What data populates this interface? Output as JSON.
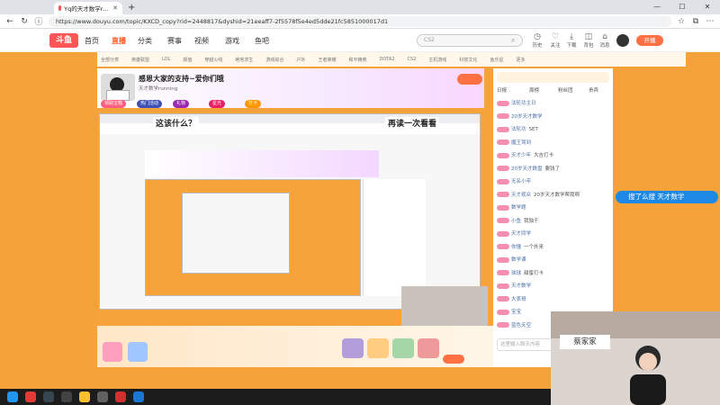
{
  "browser": {
    "tabs": [
      {
        "label": "Yq的天才数学running直播 - 斗鱼"
      },
      {
        "label": "+"
      }
    ],
    "url": "https://www.douyu.com/topic/KXCD_copy?rid=2448817&dyshid=21eeaff7-2f5578f5e4ed5dde21fc5851000017d1",
    "window_controls": [
      "—",
      "☐",
      "✕"
    ]
  },
  "site": {
    "logo": "斗鱼",
    "nav": [
      "首页",
      "直播",
      "分类",
      "赛事",
      "视频",
      "游戏",
      "鱼吧"
    ],
    "search_placeholder": "CS2",
    "header_icons": [
      {
        "icon": "clock-icon",
        "label": "历史"
      },
      {
        "icon": "heart-icon",
        "label": "关注"
      },
      {
        "icon": "download-icon",
        "label": "下载"
      },
      {
        "icon": "bag-icon",
        "label": "背包"
      },
      {
        "icon": "bell-icon",
        "label": "消息"
      }
    ],
    "open_live": "开播",
    "accent": "#ff7043",
    "brand_orange": "#f6a23a"
  },
  "category_strip": [
    "全部分类",
    "英雄联盟",
    "LOL",
    "颜值",
    "穿越火线",
    "绝地求生",
    "游戏综合",
    "户外",
    "王者荣耀",
    "和平精英",
    "DOTA2",
    "CS2",
    "主机游戏",
    "科技文化",
    "鱼乐星",
    "更多"
  ],
  "room": {
    "title": "感恩大家的支持~爱你们哦",
    "streamer": "天才数学running",
    "tags": [
      "人气",
      "关注",
      "粉丝团"
    ],
    "pills": [
      "领取宝箱",
      "热门活动",
      "礼物",
      "星光",
      "打卡"
    ],
    "overlay_left": "这该什么？",
    "overlay_right": "再读一次看看",
    "sign_text": "蔡家家"
  },
  "right_panel": {
    "tabs": [
      "日报",
      "周榜",
      "粉丝团",
      "贵宾"
    ],
    "chat": [
      {
        "user": "法轮功主日",
        "msg": ""
      },
      {
        "user": "20岁天才数学",
        "msg": ""
      },
      {
        "user": "法轮功",
        "msg": "SET"
      },
      {
        "user": "魔王驾到",
        "msg": ""
      },
      {
        "user": "天才少年",
        "msg": "大吉打卡"
      },
      {
        "user": "20岁天才跌盘",
        "msg": "要钱了"
      },
      {
        "user": "无名小卒",
        "msg": ""
      },
      {
        "user": "天才观众",
        "msg": "20岁天才数学帮我啊"
      },
      {
        "user": "数学题",
        "msg": ""
      },
      {
        "user": "小鱼",
        "msg": "我独干"
      },
      {
        "user": "天才同学",
        "msg": ""
      },
      {
        "user": "你懂",
        "msg": "一个外来"
      },
      {
        "user": "数学课",
        "msg": ""
      },
      {
        "user": "球球",
        "msg": "甜蜜打卡"
      },
      {
        "user": "天才数学",
        "msg": ""
      },
      {
        "user": "大表哥",
        "msg": ""
      },
      {
        "user": "宝宝",
        "msg": ""
      },
      {
        "user": "蓝色天空",
        "msg": ""
      }
    ],
    "input_placeholder": "这里输入聊天内容",
    "send_label": "发送"
  },
  "floating": {
    "search_tag": "搜了么搜 天才数学"
  },
  "taskbar": {
    "icons": [
      "windows-icon",
      "browser-icon",
      "steam-icon",
      "obs-icon",
      "chrome-icon",
      "app-icon",
      "netease-icon",
      "settings-icon"
    ]
  }
}
